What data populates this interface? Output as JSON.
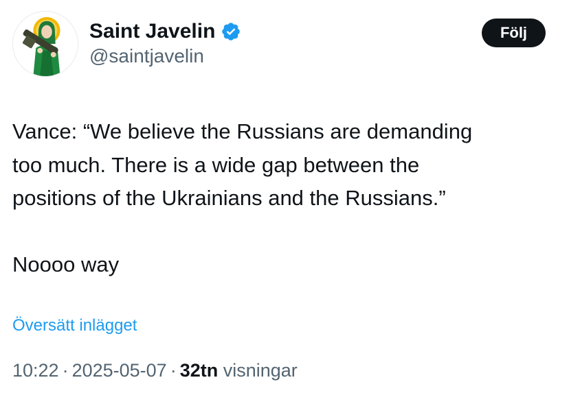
{
  "author": {
    "display_name": "Saint Javelin",
    "handle": "@saintjavelin",
    "verified": true,
    "verified_color": "#1d9bf0"
  },
  "follow_button": {
    "label": "Följ"
  },
  "tweet": {
    "lines": [
      "Vance: “We believe the Russians are demanding",
      "too much. There is a wide gap between the",
      "positions of the Ukrainians and the Russians.”",
      "Noooo way"
    ]
  },
  "translate_link": {
    "label": "Översätt inlägget"
  },
  "meta": {
    "time": "10:22",
    "separator": "·",
    "date": "2025-05-07",
    "views_count": "32tn",
    "views_label": "visningar"
  },
  "colors": {
    "text_primary": "#0f1419",
    "text_secondary": "#536471",
    "link": "#1d9bf0",
    "button_bg": "#0f1419"
  },
  "icons": {
    "avatar": "saint-javelin-icon-avatar",
    "verified": "verified-badge-icon"
  }
}
